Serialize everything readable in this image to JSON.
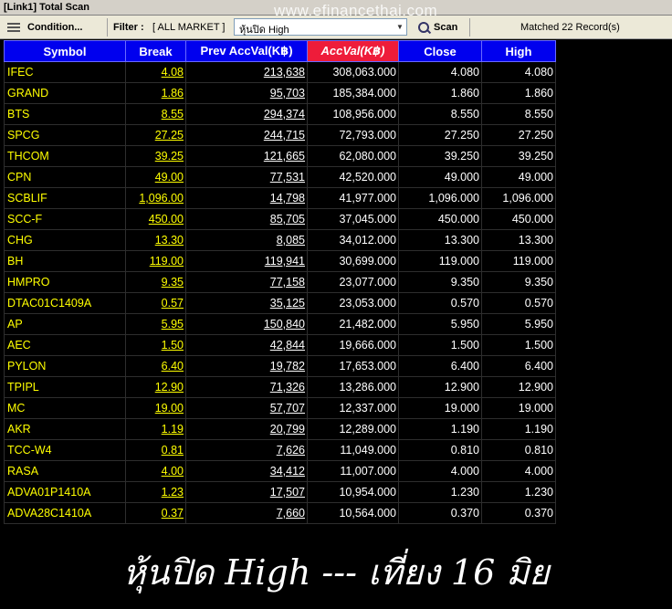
{
  "window": {
    "title": "[Link1] Total Scan"
  },
  "watermark": "www.efinancethai.com",
  "toolbar": {
    "condition_label": "Condition...",
    "filter_label": "Filter :",
    "filter_value": "[ ALL MARKET ]",
    "scan_combo_value": "หุ้นปิด High",
    "scan_label": "Scan",
    "matched_text": "Matched 22 Record(s)"
  },
  "table": {
    "columns": [
      "Symbol",
      "Break",
      "Prev AccVal(K฿)",
      "AccVal(K฿)",
      "Close",
      "High"
    ],
    "rows": [
      [
        "IFEC",
        "4.08",
        "213,638",
        "308,063.000",
        "4.080",
        "4.080"
      ],
      [
        "GRAND",
        "1.86",
        "95,703",
        "185,384.000",
        "1.860",
        "1.860"
      ],
      [
        "BTS",
        "8.55",
        "294,374",
        "108,956.000",
        "8.550",
        "8.550"
      ],
      [
        "SPCG",
        "27.25",
        "244,715",
        "72,793.000",
        "27.250",
        "27.250"
      ],
      [
        "THCOM",
        "39.25",
        "121,665",
        "62,080.000",
        "39.250",
        "39.250"
      ],
      [
        "CPN",
        "49.00",
        "77,531",
        "42,520.000",
        "49.000",
        "49.000"
      ],
      [
        "SCBLIF",
        "1,096.00",
        "14,798",
        "41,977.000",
        "1,096.000",
        "1,096.000"
      ],
      [
        "SCC-F",
        "450.00",
        "85,705",
        "37,045.000",
        "450.000",
        "450.000"
      ],
      [
        "CHG",
        "13.30",
        "8,085",
        "34,012.000",
        "13.300",
        "13.300"
      ],
      [
        "BH",
        "119.00",
        "119,941",
        "30,699.000",
        "119.000",
        "119.000"
      ],
      [
        "HMPRO",
        "9.35",
        "77,158",
        "23,077.000",
        "9.350",
        "9.350"
      ],
      [
        "DTAC01C1409A",
        "0.57",
        "35,125",
        "23,053.000",
        "0.570",
        "0.570"
      ],
      [
        "AP",
        "5.95",
        "150,840",
        "21,482.000",
        "5.950",
        "5.950"
      ],
      [
        "AEC",
        "1.50",
        "42,844",
        "19,666.000",
        "1.500",
        "1.500"
      ],
      [
        "PYLON",
        "6.40",
        "19,782",
        "17,653.000",
        "6.400",
        "6.400"
      ],
      [
        "TPIPL",
        "12.90",
        "71,326",
        "13,286.000",
        "12.900",
        "12.900"
      ],
      [
        "MC",
        "19.00",
        "57,707",
        "12,337.000",
        "19.000",
        "19.000"
      ],
      [
        "AKR",
        "1.19",
        "20,799",
        "12,289.000",
        "1.190",
        "1.190"
      ],
      [
        "TCC-W4",
        "0.81",
        "7,626",
        "11,049.000",
        "0.810",
        "0.810"
      ],
      [
        "RASA",
        "4.00",
        "34,412",
        "11,007.000",
        "4.000",
        "4.000"
      ],
      [
        "ADVA01P1410A",
        "1.23",
        "17,507",
        "10,954.000",
        "1.230",
        "1.230"
      ],
      [
        "ADVA28C1410A",
        "0.37",
        "7,660",
        "10,564.000",
        "0.370",
        "0.370"
      ]
    ]
  },
  "caption": "หุ้นปิด High  --- เที่ยง 16 มิย",
  "colors": {
    "header_bg": "#0000ee",
    "sorted_header_bg": "#ee1c3a",
    "symbol_text": "#ffff00",
    "value_text": "#ffffff",
    "background": "#000000"
  }
}
